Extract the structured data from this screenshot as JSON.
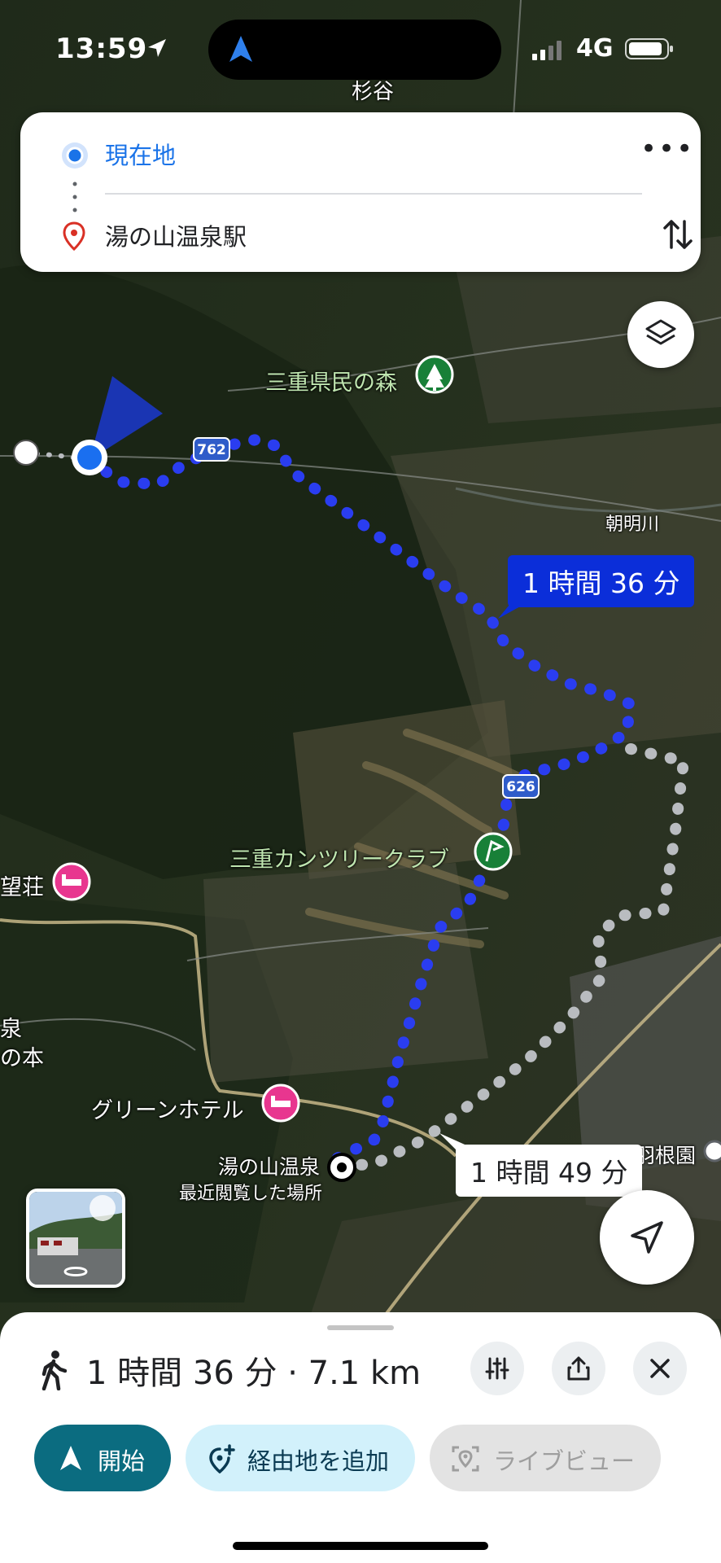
{
  "status_bar": {
    "time": "13:59",
    "network": "4G"
  },
  "directions": {
    "origin": "現在地",
    "destination": "湯の山温泉駅"
  },
  "map": {
    "labels": {
      "top_partial": "杉谷",
      "forest": "三重県民の森",
      "river": "朝明川",
      "golf": "三重カンツリークラブ",
      "hotel_left_partial": "望荘",
      "onsen_partial": "泉",
      "no_hon_partial": "の本",
      "green_hotel": "グリーンホテル",
      "station": "湯の山温泉",
      "recent": "最近閲覧した場所",
      "hane": "羽根園"
    },
    "road_shields": {
      "r762": "762",
      "r626": "626"
    },
    "route_times": {
      "selected": "1 時間 36 分",
      "alternate": "1 時間 49 分"
    }
  },
  "sheet": {
    "summary": "1 時間 36 分 · 7.1 km",
    "start_label": "開始",
    "add_stop_label": "経由地を追加",
    "live_view_label": "ライブビュー"
  },
  "colors": {
    "route_blue": "#2a3df0",
    "alt_route": "#b9bcc0",
    "accent_teal": "#0b6c80",
    "link_blue": "#1a73e8",
    "pin_red": "#d93025"
  }
}
